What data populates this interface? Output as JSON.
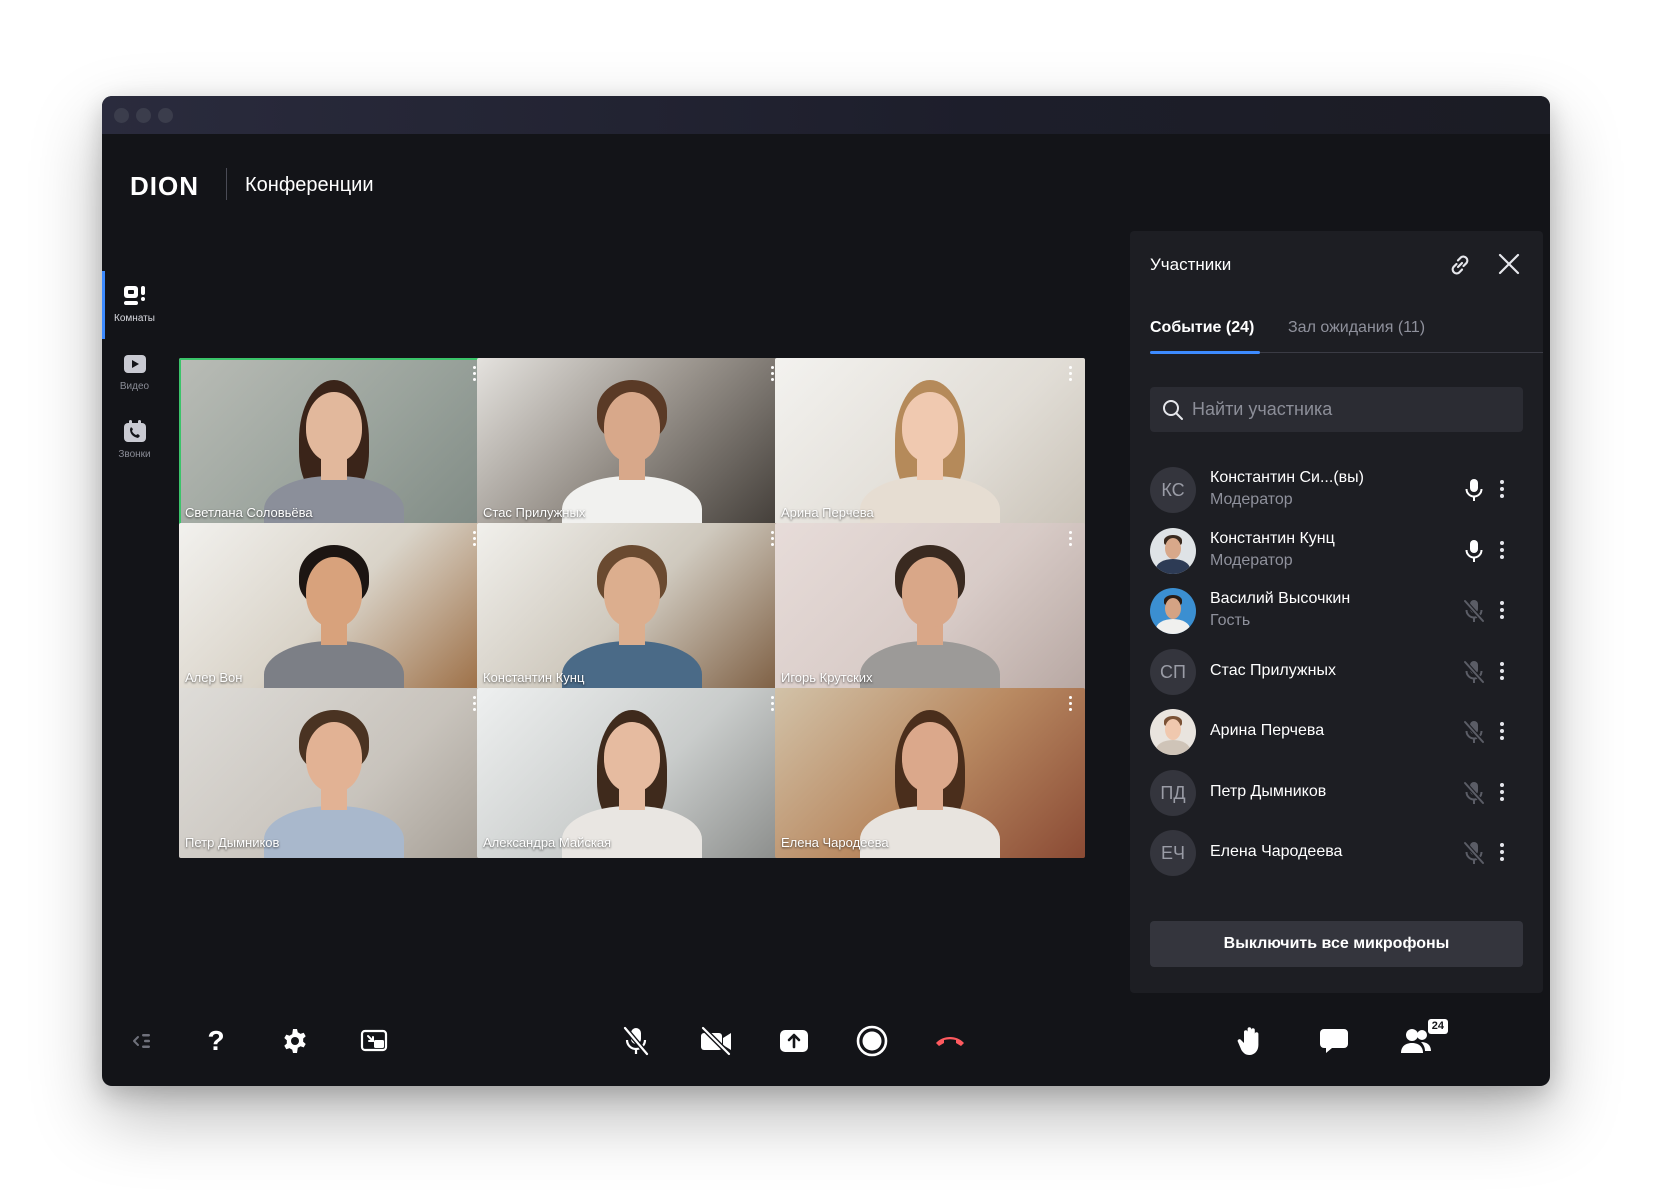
{
  "app": {
    "logo": "DION",
    "title": "Конференции"
  },
  "nav": [
    {
      "label": "Комнаты",
      "icon": "rooms-icon",
      "active": true
    },
    {
      "label": "Видео",
      "icon": "video-play-icon",
      "active": false
    },
    {
      "label": "Звонки",
      "icon": "calls-icon",
      "active": false
    }
  ],
  "tiles": [
    {
      "name": "Светлана Соловьёва",
      "speaking": true
    },
    {
      "name": "Стас Прилужных",
      "speaking": false
    },
    {
      "name": "Арина Перчева",
      "speaking": false
    },
    {
      "name": "Алер Вон",
      "speaking": false
    },
    {
      "name": "Константин Кунц",
      "speaking": false
    },
    {
      "name": "Игорь Крутских",
      "speaking": false
    },
    {
      "name": "Петр Дымников",
      "speaking": false
    },
    {
      "name": "Александра Майская",
      "speaking": false
    },
    {
      "name": "Елена Чародеева",
      "speaking": false
    }
  ],
  "panel": {
    "title": "Участники",
    "tabs": [
      "Событие (24)",
      "Зал ожидания (11)"
    ],
    "search_placeholder": "Найти участника",
    "participants": [
      {
        "initials": "КС",
        "name": "Константин Си...(вы)",
        "role": "Модератор",
        "mic": "on"
      },
      {
        "initials": "",
        "name": "Константин Кунц",
        "role": "Модератор",
        "mic": "on"
      },
      {
        "initials": "",
        "name": "Василий Высочкин",
        "role": "Гость",
        "mic": "off"
      },
      {
        "initials": "СП",
        "name": "Стас Прилужных",
        "role": "",
        "mic": "off"
      },
      {
        "initials": "",
        "name": "Арина Перчева",
        "role": "",
        "mic": "off"
      },
      {
        "initials": "ПД",
        "name": "Петр Дымников",
        "role": "",
        "mic": "off"
      },
      {
        "initials": "ЕЧ",
        "name": "Елена Чародеева",
        "role": "",
        "mic": "off"
      }
    ],
    "mute_all_label": "Выключить все микрофоны"
  },
  "toolbar": {
    "help_label": "?",
    "participants_count": "24",
    "hangup_color": "#ff5a5f"
  },
  "colors": {
    "accent": "#3d8bff",
    "speaking": "#3bc46a",
    "background": "#131418",
    "panel": "#1d1e23"
  }
}
